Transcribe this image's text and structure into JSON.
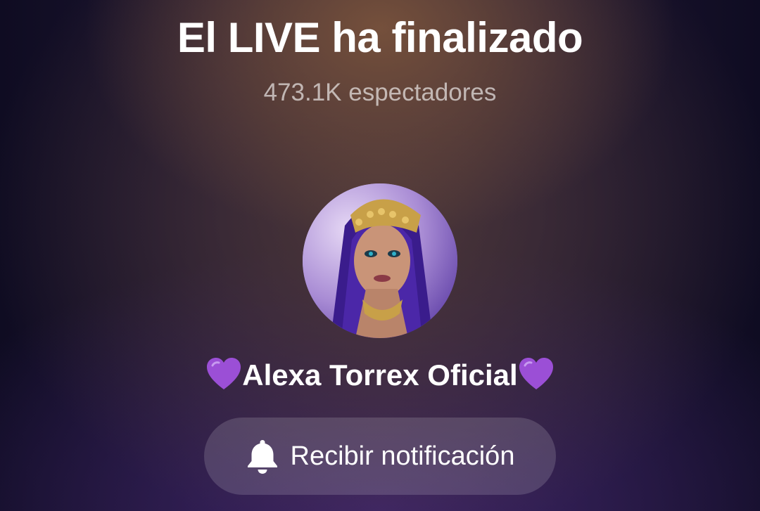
{
  "live_ended": {
    "title": "El LIVE ha finalizado",
    "viewers": "473.1K espectadores"
  },
  "host": {
    "display_name": "Alexa Torrex Oficial",
    "name_prefix_emoji": "purple-heart",
    "name_suffix_emoji": "purple-heart",
    "avatar": "profile-photo"
  },
  "notify_button": {
    "label": "Recibir notificación",
    "icon": "bell-icon"
  },
  "colors": {
    "heart": "#9b4fd6",
    "button_bg": "rgba(255,255,255,0.15)"
  }
}
